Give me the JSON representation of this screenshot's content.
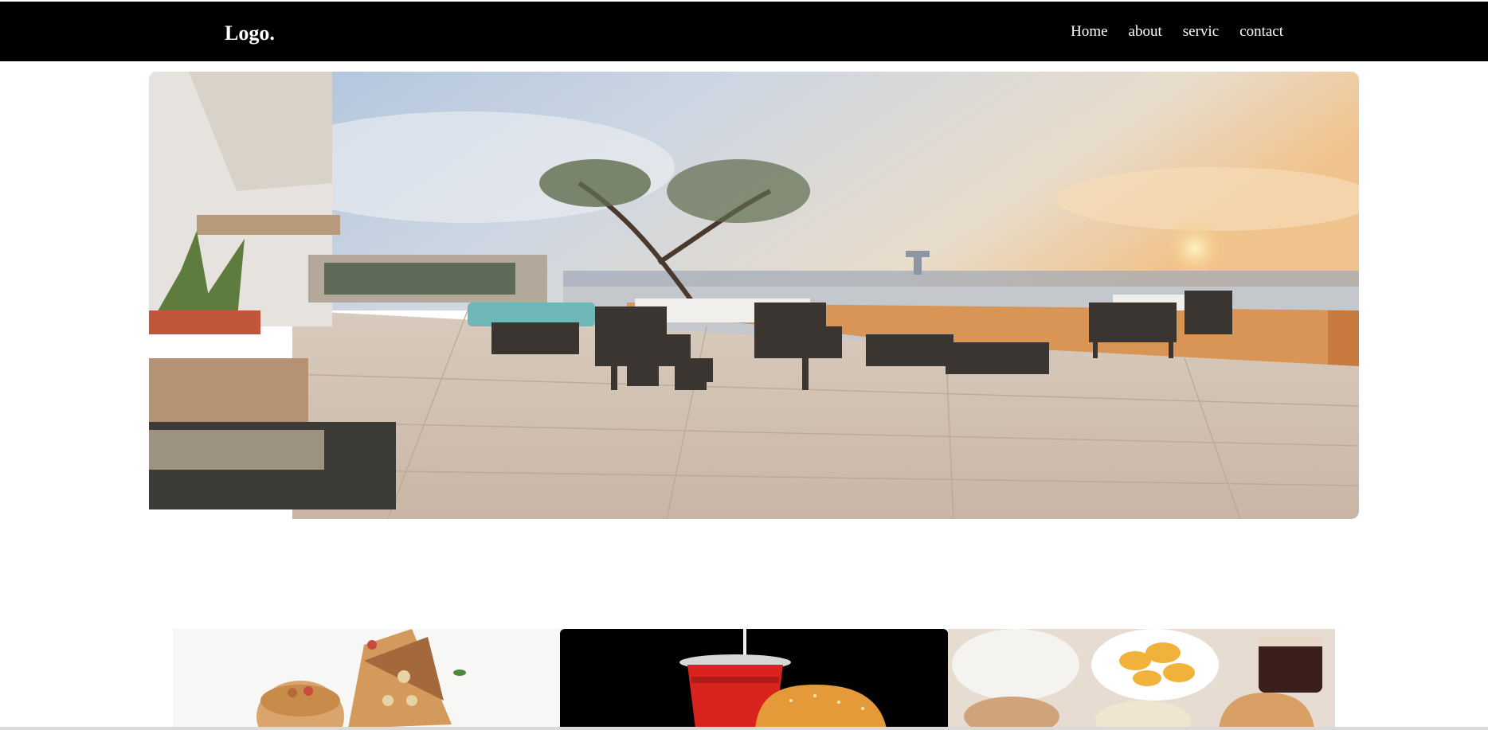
{
  "nav": {
    "logo": "Logo.",
    "links": [
      {
        "label": "Home"
      },
      {
        "label": "about"
      },
      {
        "label": "servic"
      },
      {
        "label": "contact"
      }
    ]
  },
  "hero": {
    "image": "restaurant-terrace-image"
  },
  "cards": [
    {
      "image": "sandwich-image"
    },
    {
      "image": "soda-burger-image"
    },
    {
      "image": "snacks-platter-image"
    }
  ],
  "colors": {
    "navbar_bg": "#000000",
    "nav_text": "#ffffff",
    "page_bg": "#ffffff"
  }
}
